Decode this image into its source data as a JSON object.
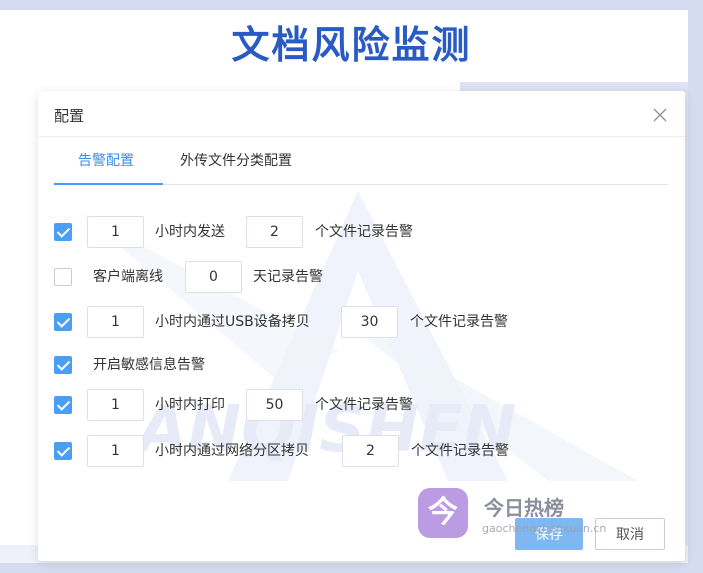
{
  "banner": {
    "title": "文档风险监测"
  },
  "dialog": {
    "title": "配置",
    "close_icon": "close-icon",
    "tabs": [
      {
        "label": "告警配置",
        "active": true
      },
      {
        "label": "外传文件分类配置",
        "active": false
      }
    ],
    "rules": {
      "send": {
        "checked": true,
        "hours": "1",
        "text1": "小时内发送",
        "count": "2",
        "text2": "个文件记录告警"
      },
      "offline": {
        "checked": false,
        "text1": "客户端离线",
        "days": "0",
        "text2": "天记录告警"
      },
      "usb": {
        "checked": true,
        "hours": "1",
        "text1": "小时内通过USB设备拷贝",
        "count": "30",
        "text2": "个文件记录告警"
      },
      "sensitive": {
        "checked": true,
        "text1": "开启敏感信息告警"
      },
      "print": {
        "checked": true,
        "hours": "1",
        "text1": "小时内打印",
        "count": "50",
        "text2": "个文件记录告警"
      },
      "network": {
        "checked": true,
        "hours": "1",
        "text1": "小时内通过网络分区拷贝",
        "count": "2",
        "text2": "个文件记录告警"
      }
    },
    "footer": {
      "save_label": "保存",
      "cancel_label": "取消"
    }
  },
  "watermark": {
    "text": "ANQISHEN"
  },
  "overlay_logo": {
    "badge": "今",
    "name": "今日热榜",
    "url": "gaochengzhenxuan.cn"
  },
  "colors": {
    "accent": "#409eff",
    "banner_title": "#2a5bc4",
    "checkbox": "#4a9ff5"
  }
}
